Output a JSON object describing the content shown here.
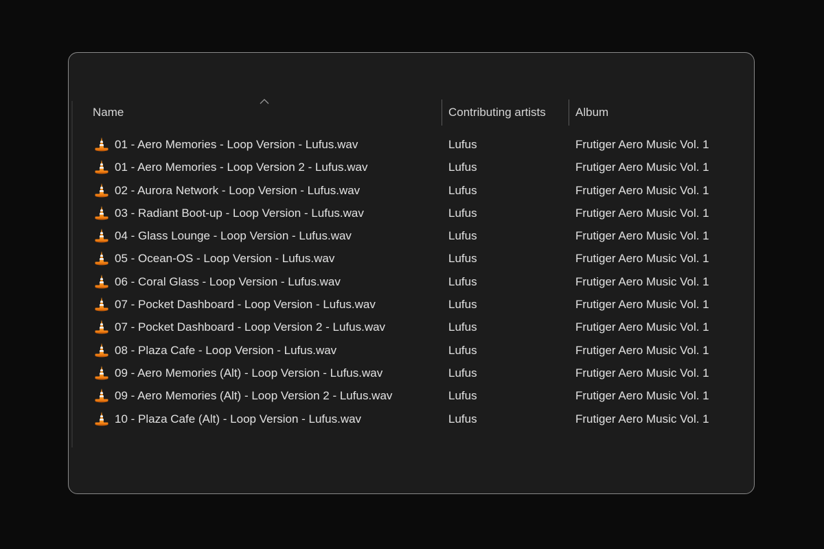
{
  "columns": {
    "name": "Name",
    "artists": "Contributing artists",
    "album": "Album"
  },
  "file_icon": "vlc-cone-icon",
  "colors": {
    "background": "#0b0b0b",
    "panel": "#1c1c1c",
    "text": "#e2e2e2",
    "icon_orange": "#f07f14"
  },
  "files": [
    {
      "name": "01 - Aero Memories - Loop Version - Lufus.wav",
      "artist": "Lufus",
      "album": "Frutiger Aero Music Vol. 1"
    },
    {
      "name": "01 - Aero Memories - Loop Version 2 - Lufus.wav",
      "artist": "Lufus",
      "album": "Frutiger Aero Music Vol. 1"
    },
    {
      "name": "02 - Aurora Network - Loop Version - Lufus.wav",
      "artist": "Lufus",
      "album": "Frutiger Aero Music Vol. 1"
    },
    {
      "name": "03 - Radiant Boot-up - Loop Version - Lufus.wav",
      "artist": "Lufus",
      "album": "Frutiger Aero Music Vol. 1"
    },
    {
      "name": "04 - Glass Lounge - Loop Version - Lufus.wav",
      "artist": "Lufus",
      "album": "Frutiger Aero Music Vol. 1"
    },
    {
      "name": "05 - Ocean-OS - Loop Version - Lufus.wav",
      "artist": "Lufus",
      "album": "Frutiger Aero Music Vol. 1"
    },
    {
      "name": "06 - Coral Glass - Loop Version - Lufus.wav",
      "artist": "Lufus",
      "album": "Frutiger Aero Music Vol. 1"
    },
    {
      "name": "07 - Pocket Dashboard - Loop Version - Lufus.wav",
      "artist": "Lufus",
      "album": "Frutiger Aero Music Vol. 1"
    },
    {
      "name": "07 - Pocket Dashboard - Loop Version 2 - Lufus.wav",
      "artist": "Lufus",
      "album": "Frutiger Aero Music Vol. 1"
    },
    {
      "name": "08 - Plaza Cafe - Loop Version - Lufus.wav",
      "artist": "Lufus",
      "album": "Frutiger Aero Music Vol. 1"
    },
    {
      "name": "09 - Aero Memories (Alt) - Loop Version - Lufus.wav",
      "artist": "Lufus",
      "album": "Frutiger Aero Music Vol. 1"
    },
    {
      "name": "09 - Aero Memories (Alt) - Loop Version 2 - Lufus.wav",
      "artist": "Lufus",
      "album": "Frutiger Aero Music Vol. 1"
    },
    {
      "name": "10 - Plaza Cafe (Alt) - Loop Version - Lufus.wav",
      "artist": "Lufus",
      "album": "Frutiger Aero Music Vol. 1"
    }
  ]
}
